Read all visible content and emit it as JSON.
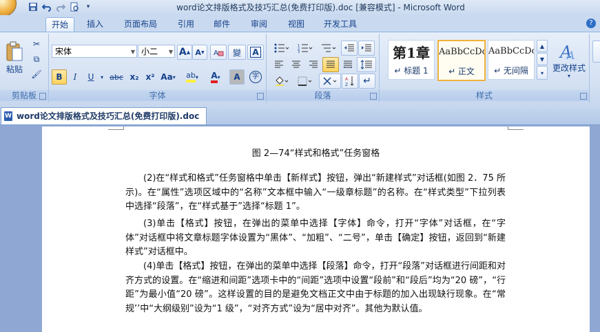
{
  "window": {
    "title": "word论文排版格式及技巧汇总(免费打印版).doc [兼容模式] - Microsoft Word"
  },
  "quick_access": {
    "icons": [
      "save-icon",
      "undo-icon",
      "redo-icon",
      "print-preview-icon",
      "customize-qat-icon"
    ]
  },
  "ribbon_tabs": [
    {
      "label": "开始",
      "active": true
    },
    {
      "label": "插入"
    },
    {
      "label": "页面布局"
    },
    {
      "label": "引用"
    },
    {
      "label": "邮件"
    },
    {
      "label": "审阅"
    },
    {
      "label": "视图"
    },
    {
      "label": "开发工具"
    }
  ],
  "clipboard": {
    "paste_label": "粘贴",
    "group_label": "剪贴板"
  },
  "font": {
    "font_name": "宋体",
    "font_size": "小二",
    "group_label": "字体",
    "buttons": {
      "grow": "A",
      "shrink": "A",
      "bold": "B",
      "italic": "I",
      "underline": "U",
      "strike": "abc",
      "subscript": "x₂",
      "superscript": "x²",
      "change_case": "Aa",
      "highlight": "ab",
      "font_color": "A",
      "char_shading": "A",
      "enclose": "字",
      "phonetic": "變",
      "char_border": "A"
    }
  },
  "paragraph": {
    "group_label": "段落"
  },
  "styles": {
    "group_label": "样式",
    "items": [
      {
        "sample": "第1章",
        "name": "↵ 标题 1"
      },
      {
        "sample": "AaBbCcDc",
        "name": "↵ 正文",
        "selected": true
      },
      {
        "sample": "AaBbCcDc",
        "name": "↵ 无间隔"
      }
    ],
    "change_styles_label": "更改样式"
  },
  "doc_tab": {
    "label": "word论文排版格式及技巧汇总(免费打印版).doc"
  },
  "document": {
    "caption": "图 2—74“样式和格式”任务窗格",
    "paragraphs": [
      "(2)在“样式和格式”任务窗格中单击【新样式】按钮，弹出“新建样式”对话框(如图 2．75 所示)。在“属性”选项区域中的“名称”文本框中输入“一级章标题”的名称。在“样式类型”下拉列表中选择“段落”，在“样式基于”选择“标题 1”。",
      "(3)单击【格式】按钮，在弹出的菜单中选择【字体】命令，打开“字体”对话框，在“字体”对话框中将文章标题字体设置为“黑体”、“加粗”、“二号”，单击【确定】按钮，返回到“新建样式”对话框中。",
      "(4)单击【格式】按钮，在弹出的菜单中选择【段落】命令，打开“段落”对话框进行间距和对齐方式的设置。在“缩进和间距”选项卡中的“间距”选项中设置“段前”和“段后”均为“20 磅”，“行距”为最小值“20 磅”。这样设置的目的是避免文档正文中由于标题的加入出现缺行现象。在“常规’’中“大纲级别”设为“1 级”，“对齐方式”设为“居中对齐”。其他为默认值。"
    ]
  }
}
